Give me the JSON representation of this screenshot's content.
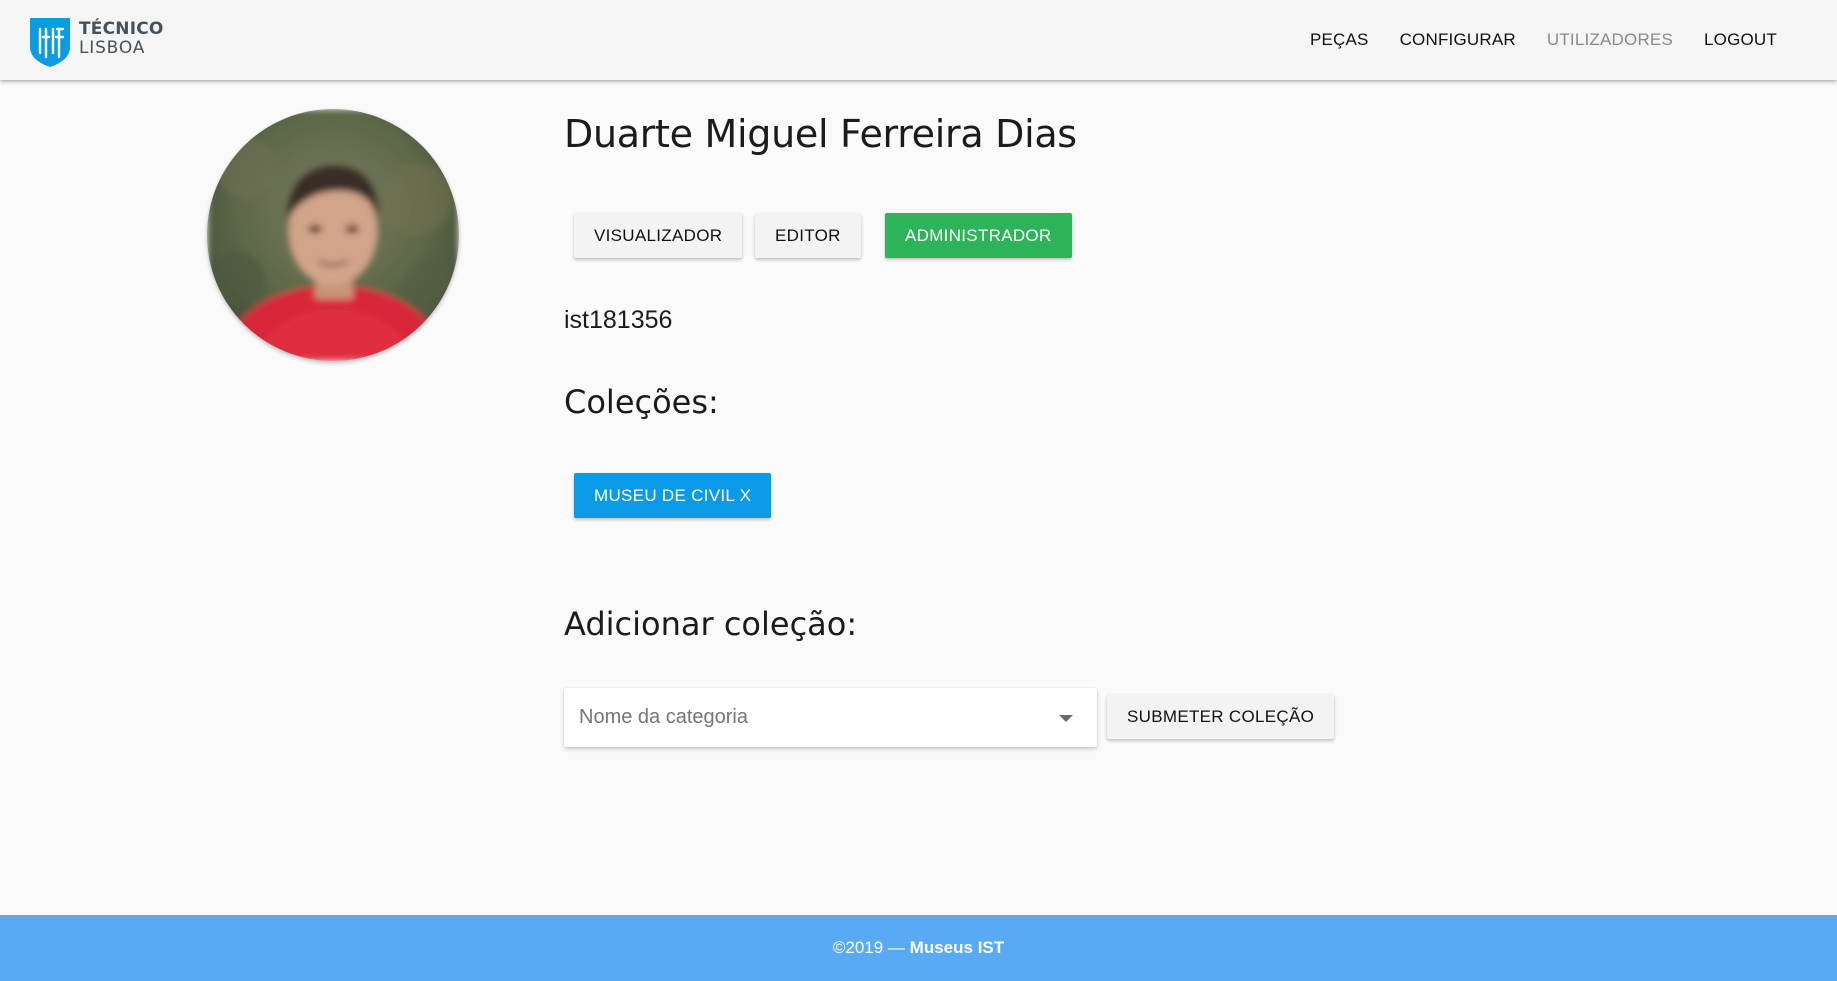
{
  "header": {
    "logo": {
      "line1": "TÉCNICO",
      "line2": "LISBOA",
      "brand_color": "#0a9be0"
    },
    "nav": [
      {
        "label": "PEÇAS",
        "active": false
      },
      {
        "label": "CONFIGURAR",
        "active": false
      },
      {
        "label": "UTILIZADORES",
        "active": true
      },
      {
        "label": "LOGOUT",
        "active": false
      }
    ]
  },
  "profile": {
    "name": "Duarte Miguel Ferreira Dias",
    "roles": [
      {
        "label": "VISUALIZADOR",
        "selected": false
      },
      {
        "label": "EDITOR",
        "selected": false
      },
      {
        "label": "ADMINISTRADOR",
        "selected": true
      }
    ],
    "username": "ist181356"
  },
  "collections": {
    "title": "Coleções:",
    "items": [
      {
        "label": "MUSEU DE CIVIL X"
      }
    ]
  },
  "add_collection": {
    "title": "Adicionar coleção:",
    "select_placeholder": "Nome da categoria",
    "submit_label": "SUBMETER COLEÇÃO"
  },
  "footer": {
    "copyright": "©2019 —",
    "brand": "Museus IST"
  },
  "colors": {
    "accent_green": "#2db45a",
    "accent_blue": "#0b9ae8",
    "footer_blue": "#59aaf4"
  }
}
